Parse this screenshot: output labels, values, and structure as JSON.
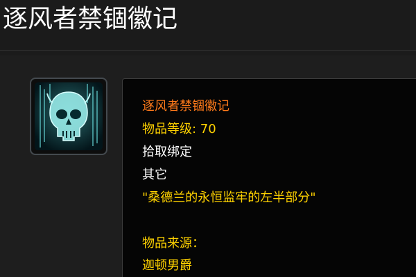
{
  "header": {
    "title": "逐风者禁锢徽记"
  },
  "item": {
    "icon": "skull-icon",
    "name": "逐风者禁锢徽记",
    "level_text": "物品等级: 70",
    "bind_text": "拾取绑定",
    "category": "其它",
    "flavor_text": "\"桑德兰的永恒监牢的左半部分\"",
    "source_label": "物品来源：",
    "source_name": "迦顿男爵"
  },
  "colors": {
    "item_name": "#ff7a1a",
    "gold_text": "#ffd200",
    "white_text": "#ffffff",
    "icon_glow": "#5fe0e0"
  }
}
